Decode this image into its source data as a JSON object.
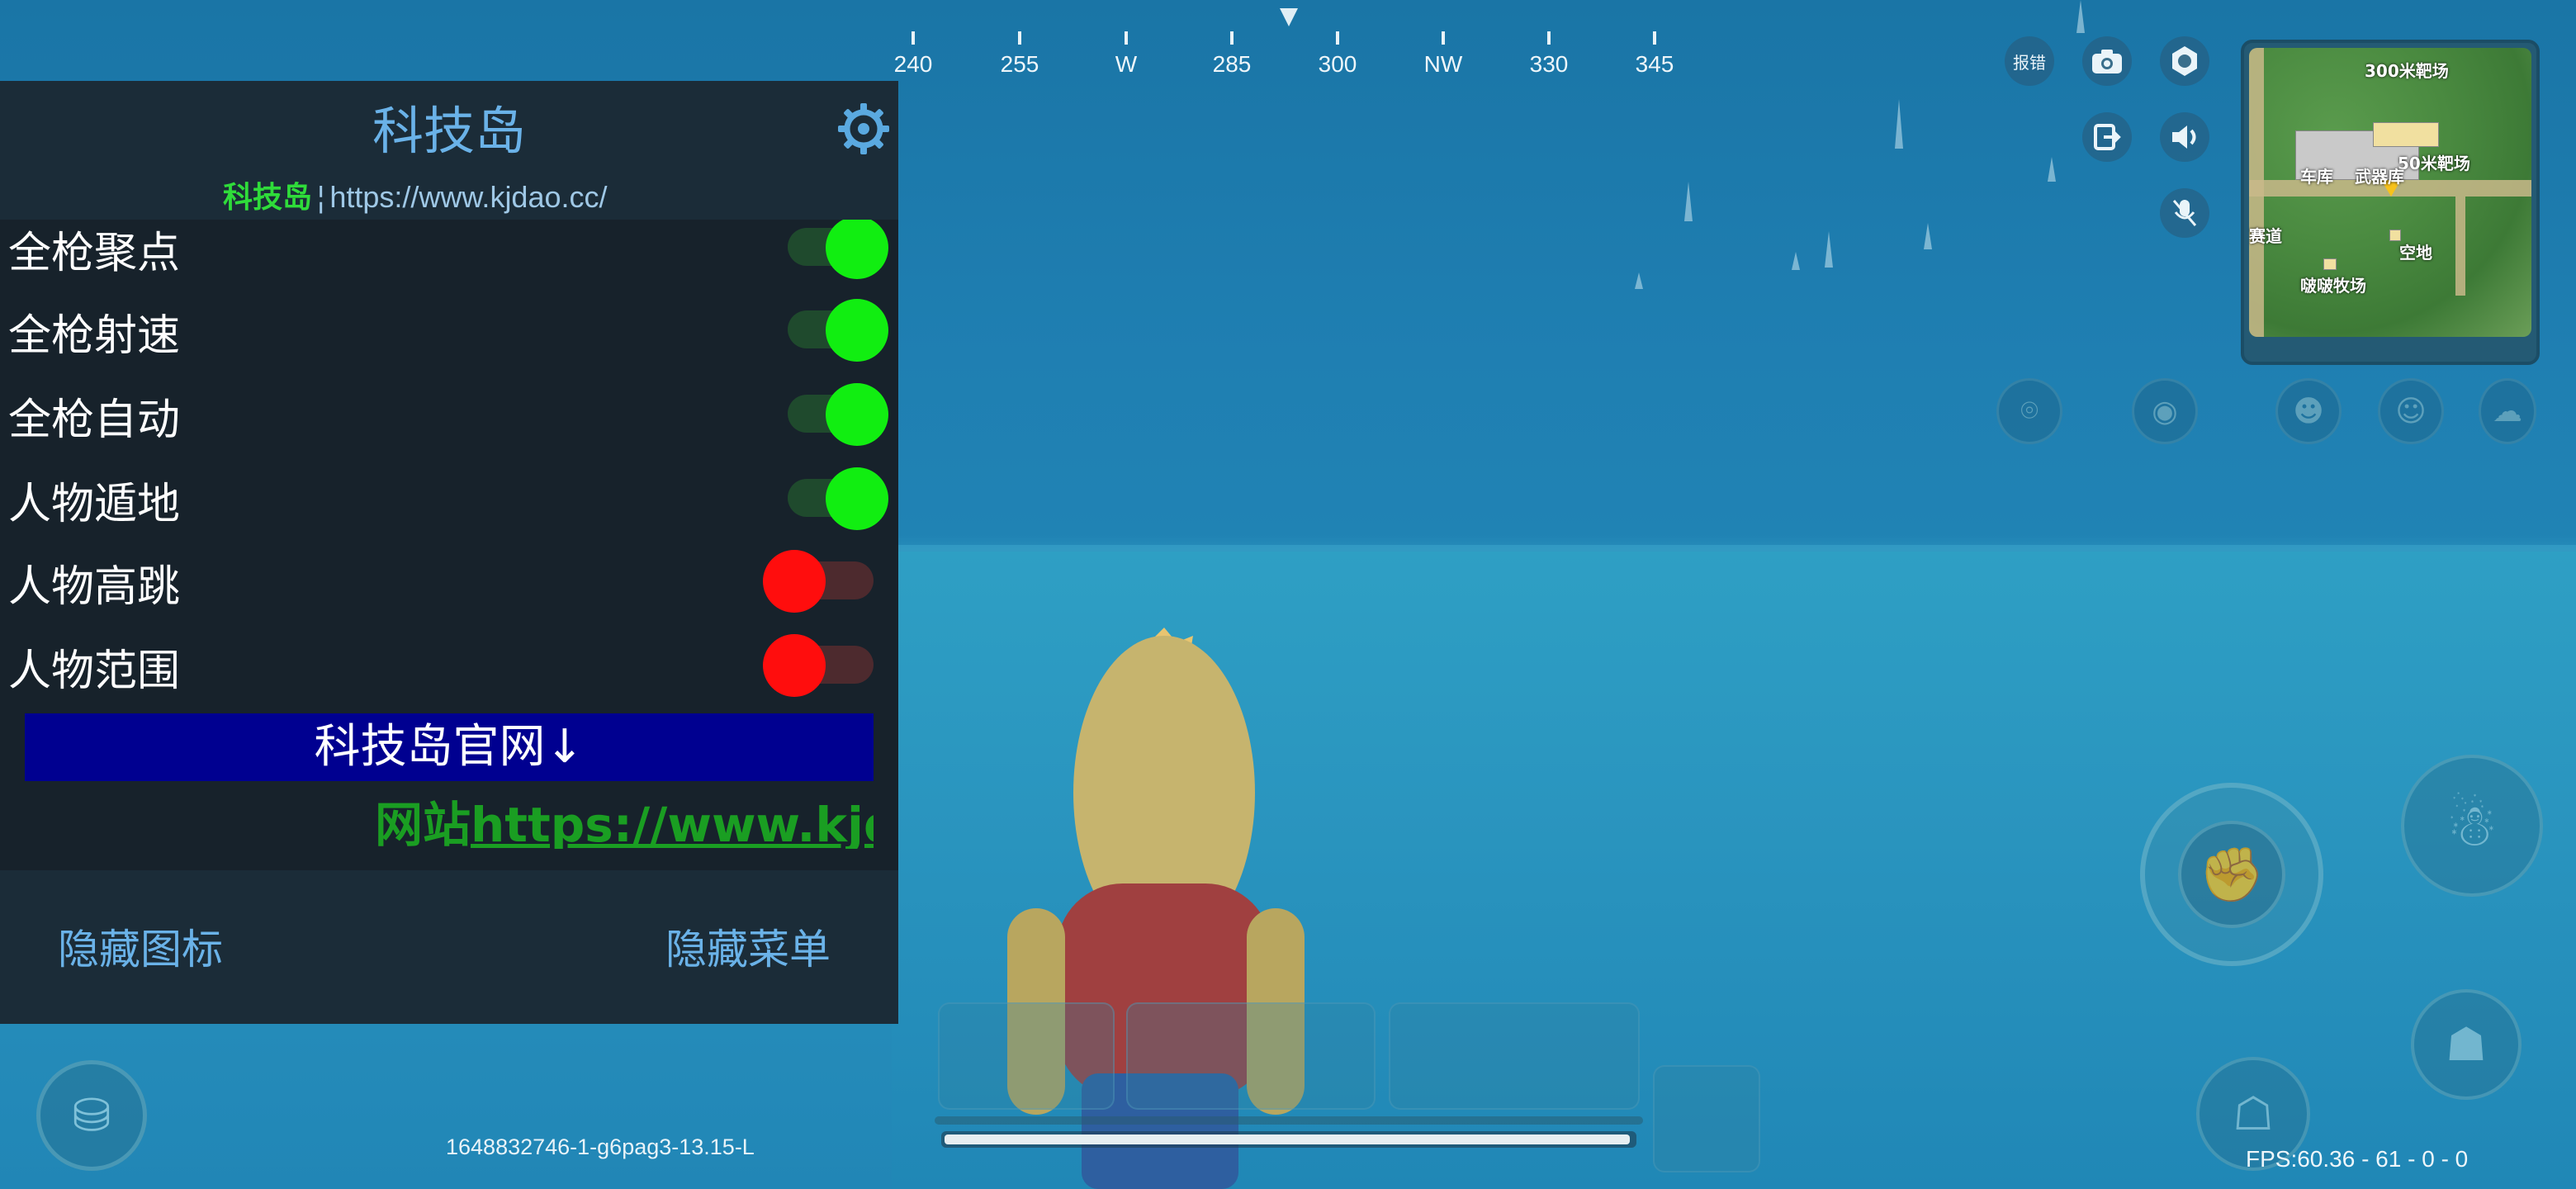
{
  "compass": {
    "labels": [
      "240",
      "255",
      "W",
      "285",
      "300",
      "NW",
      "330",
      "345"
    ]
  },
  "top_buttons": {
    "report_label": "报错"
  },
  "minimap": {
    "labels": [
      "300米靶场",
      "50米靶场",
      "车库",
      "武器库",
      "赛道",
      "空地",
      "啵啵牧场"
    ]
  },
  "menu": {
    "title": "科技岛",
    "subtitle_brand": "科技岛",
    "subtitle_sep": "¦",
    "subtitle_url": "https://www.kjdao.cc/",
    "toggles": [
      {
        "label": "全枪聚点",
        "state": "on"
      },
      {
        "label": "全枪射速",
        "state": "on"
      },
      {
        "label": "全枪自动",
        "state": "on"
      },
      {
        "label": "人物遁地",
        "state": "on"
      },
      {
        "label": "人物高跳",
        "state": "off"
      },
      {
        "label": "人物范围",
        "state": "off"
      }
    ],
    "official_banner": "科技岛官网↓",
    "marquee_prefix": "网站",
    "marquee_url": "https://www.kjda",
    "hide_icon_label": "隐藏图标",
    "hide_menu_label": "隐藏菜单"
  },
  "hud": {
    "session_id": "1648832746-1-g6pag3-13.15-L",
    "fps": "FPS:60.36 - 61 - 0 - 0",
    "health_fraction": 0.995
  },
  "colors": {
    "menu_bg": "#17222b",
    "menu_header_bg": "#1b2c38",
    "accent_blue": "#6ab2e8",
    "toggle_on": "#11ee11",
    "toggle_off": "#ff0d0d",
    "banner_bg": "#000090",
    "brand_green": "#2fdc3a"
  }
}
